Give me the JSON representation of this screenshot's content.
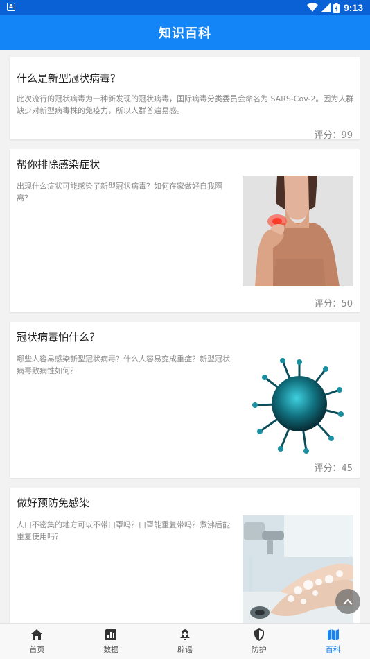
{
  "status_bar": {
    "time": "9:13",
    "notif_icon": "app-notification-icon"
  },
  "app_bar": {
    "title": "知识百科"
  },
  "cards": [
    {
      "title": "什么是新型冠状病毒？",
      "description": "此次流行的冠状病毒为一种新发现的冠状病毒，国际病毒分类委员会命名为 SARS-Cov-2。因为人群缺少对新型病毒株的免疫力，所以人群普遍易感。",
      "score": "评分：99"
    },
    {
      "title": "帮你排除感染症状",
      "description": "出现什么症状可能感染了新型冠状病毒？如何在家做好自我隔离？",
      "score": "评分：50",
      "image": "sore-throat-photo"
    },
    {
      "title": "冠状病毒怕什么？",
      "description": "哪些人容易感染新型冠状病毒？什么人容易变成重症？新型冠状病毒致病性如何？",
      "score": "评分：45",
      "image": "virus-illustration"
    },
    {
      "title": "做好预防免感染",
      "description": "人口不密集的地方可以不带口罩吗？口罩能重复带吗？煮沸后能重复使用吗？",
      "image": "hand-washing-photo"
    }
  ],
  "bottom_nav": [
    {
      "label": "首页",
      "icon": "home-icon"
    },
    {
      "label": "数据",
      "icon": "bar-chart-icon"
    },
    {
      "label": "辟谣",
      "icon": "bell-plus-icon"
    },
    {
      "label": "防护",
      "icon": "shield-icon"
    },
    {
      "label": "百科",
      "icon": "map-icon",
      "active": true
    }
  ],
  "colors": {
    "status_bar": "#0a61d6",
    "app_bar": "#1485f6",
    "active": "#1485f6"
  }
}
